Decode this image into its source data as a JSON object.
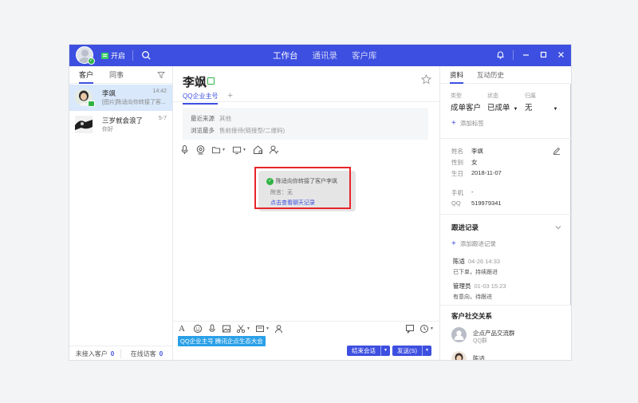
{
  "header": {
    "status_label": "开启",
    "tabs": [
      {
        "label": "工作台",
        "active": true
      },
      {
        "label": "通讯录",
        "active": false
      },
      {
        "label": "客户库",
        "active": false
      }
    ],
    "accent": "#3d4fe0"
  },
  "left_panel": {
    "tabs": [
      {
        "label": "客户",
        "active": true
      },
      {
        "label": "同事",
        "active": false
      }
    ],
    "conversations": [
      {
        "name": "李飒",
        "time": "14:42",
        "preview": "[图片]陈适向你转接了客...",
        "selected": true
      },
      {
        "name": "三岁就会浪了",
        "time": "5-7",
        "preview": "你好",
        "selected": false
      }
    ],
    "footer": {
      "pending_label": "未接入客户",
      "pending_count": "0",
      "visitors_label": "在线访客",
      "visitors_count": "0"
    }
  },
  "chat": {
    "contact_name": "李飒",
    "tab_label": "QQ企业主号",
    "tab_add": "+",
    "info": [
      {
        "key": "最近来源",
        "value": "其他"
      },
      {
        "key": "浏览最多",
        "value": "售前接待(链接型/二维码)"
      }
    ],
    "notice": {
      "title": "陈适向你转接了客户李飒",
      "attach": "附言：无",
      "link": "点击查看聊天记录"
    },
    "tag": "QQ企业主号 腾讯企点生态大会",
    "end_button": "结束会话",
    "send_button": "发送(S)"
  },
  "right_panel": {
    "tabs": [
      {
        "label": "资料",
        "active": true
      },
      {
        "label": "互动历史",
        "active": false
      }
    ],
    "type": {
      "label": "类型",
      "value": "成单客户"
    },
    "status": {
      "label": "状态",
      "value": "已成单"
    },
    "owner": {
      "label": "归属",
      "value": "无"
    },
    "add_tag": "添加标签",
    "profile": [
      {
        "key": "姓名",
        "value": "李飒"
      },
      {
        "key": "性别",
        "value": "女"
      },
      {
        "key": "生日",
        "value": "2018-11-07"
      },
      {
        "key": "手机",
        "value": "-"
      },
      {
        "key": "QQ",
        "value": "519979341"
      }
    ],
    "followup_title": "跟进记录",
    "add_followup": "添加跟进记录",
    "followups": [
      {
        "who": "陈适",
        "time": "04-26 14:33",
        "note": "已下单，持续跟进"
      },
      {
        "who": "管理员",
        "time": "01-03 15:23",
        "note": "有意向，待跟进"
      }
    ],
    "social_title": "客户社交关系",
    "social": [
      {
        "name": "企点产品交流群",
        "sub": "QQ群"
      },
      {
        "name": "陈适",
        "sub": ""
      }
    ]
  }
}
